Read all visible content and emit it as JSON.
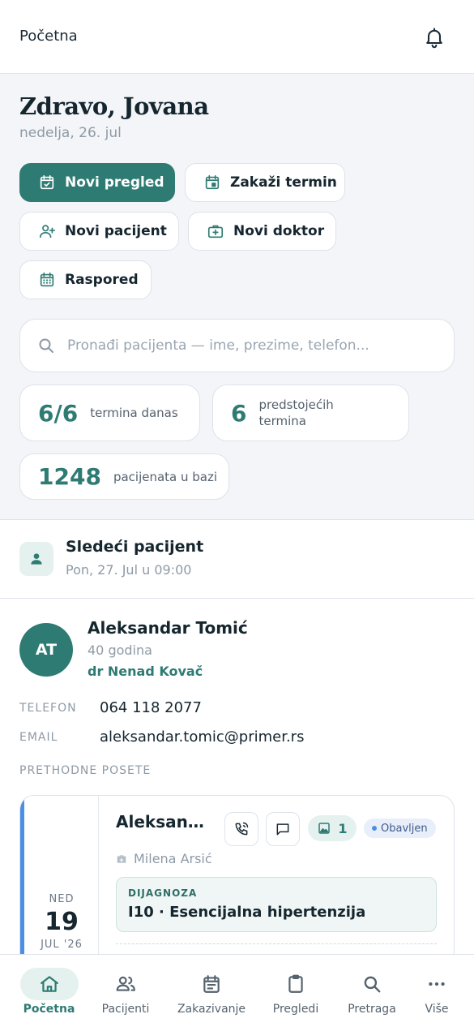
{
  "header": {
    "title": "Početna",
    "bell_icon": "bell-icon"
  },
  "greeting": {
    "title": "Zdravo, Jovana",
    "date": "nedelja, 26. jul"
  },
  "actions": {
    "new_exam": "Novi pregled",
    "schedule": "Zakaži termin",
    "new_patient": "Novi pacijent",
    "new_doctor": "Novi doktor",
    "roster": "Raspored"
  },
  "search": {
    "placeholder": "Pronađi pacijenta — ime, prezime, telefon..."
  },
  "stats": {
    "today_value": "6/6",
    "today_label": "termina danas",
    "upcoming_value": "6",
    "upcoming_label": "predstojećih termina",
    "patients_value": "1248",
    "patients_label": "pacijenata u bazi"
  },
  "next_patient": {
    "title": "Sledeći pacijent",
    "subtitle": "Pon, 27. Jul u 09:00"
  },
  "patient": {
    "initials": "AT",
    "name": "Aleksandar Tomić",
    "age": "40 godina",
    "doctor": "dr Nenad Kovač",
    "phone_label": "TELEFON",
    "phone": "064 118 2077",
    "email_label": "EMAIL",
    "email": "aleksandar.tomic@primer.rs",
    "history_label": "PRETHODNE POSETE"
  },
  "visit": {
    "weekday": "NED",
    "day": "19",
    "month_year": "JUL '26",
    "name": "Aleksandar Tomić",
    "image_count": "1",
    "status": "Obavljen",
    "doctor": "Milena Arsić",
    "diagnosis_label": "DIJAGNOZA",
    "diagnosis": "I10 · Esencijalna hipertenzija"
  },
  "nav": {
    "home": "Početna",
    "patients": "Pacijenti",
    "scheduling": "Zakazivanje",
    "exams": "Pregledi",
    "search": "Pretraga",
    "more": "Više"
  },
  "colors": {
    "primary": "#2e7b73",
    "accent_blue": "#4a8fe3",
    "background": "#f3f5f8"
  }
}
